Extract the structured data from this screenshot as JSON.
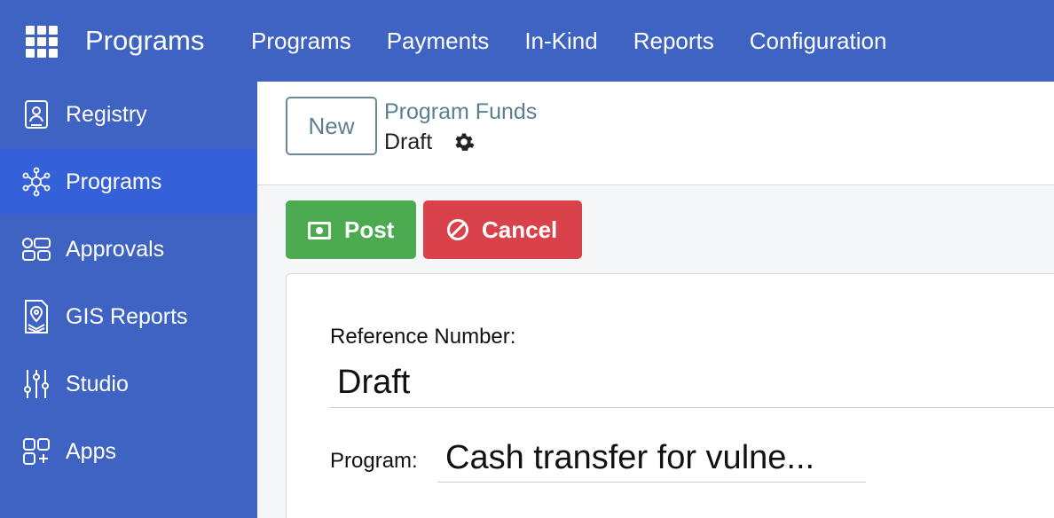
{
  "topbar": {
    "app_title": "Programs",
    "apps_icon": "grid-icon",
    "menu": [
      "Programs",
      "Payments",
      "In-Kind",
      "Reports",
      "Configuration"
    ]
  },
  "sidebar": {
    "items": [
      {
        "label": "Registry",
        "icon": "registry-icon",
        "active": false
      },
      {
        "label": "Programs",
        "icon": "programs-icon",
        "active": true
      },
      {
        "label": "Approvals",
        "icon": "approvals-icon",
        "active": false
      },
      {
        "label": "GIS Reports",
        "icon": "map-pin-icon",
        "active": false
      },
      {
        "label": "Studio",
        "icon": "sliders-icon",
        "active": false
      },
      {
        "label": "Apps",
        "icon": "apps-add-icon",
        "active": false
      }
    ]
  },
  "control_panel": {
    "new_label": "New",
    "breadcrumb": "Program Funds",
    "record_name": "Draft"
  },
  "actions": {
    "post_label": "Post",
    "cancel_label": "Cancel"
  },
  "form": {
    "reference_label": "Reference Number:",
    "reference_value": "Draft",
    "program_label": "Program:",
    "program_value": "Cash transfer for vulne..."
  },
  "colors": {
    "navbar": "#3f63c3",
    "sidebar_active": "#3561d8",
    "post": "#4caa50",
    "cancel": "#d9424a",
    "link": "#5b7f90"
  }
}
